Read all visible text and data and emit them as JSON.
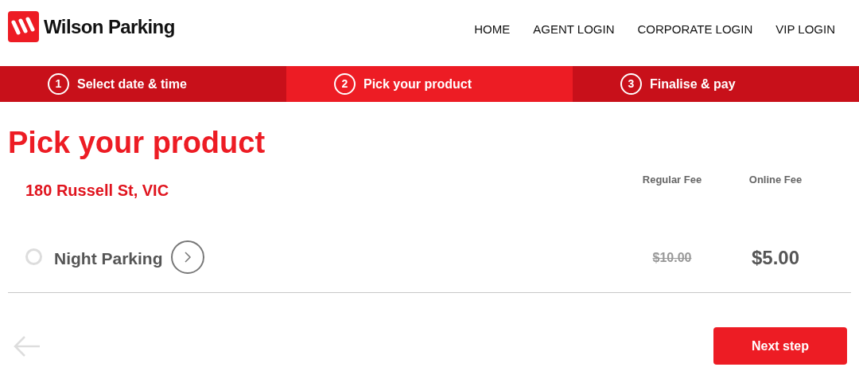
{
  "header": {
    "brand": "Wilson Parking",
    "nav": [
      "HOME",
      "AGENT LOGIN",
      "CORPORATE LOGIN",
      "VIP LOGIN"
    ]
  },
  "steps": [
    {
      "number": "1",
      "label": "Select date & time",
      "selected": false
    },
    {
      "number": "2",
      "label": "Pick your product",
      "selected": true
    },
    {
      "number": "3",
      "label": "Finalise & pay",
      "selected": false
    }
  ],
  "title": "Pick your product",
  "location": "180 Russell St, VIC",
  "columns": [
    "Regular Fee",
    "Online Fee"
  ],
  "products": [
    {
      "name": "Night Parking",
      "selected": false,
      "regular_fee": "$10.00",
      "online_fee": "$5.00"
    }
  ],
  "footer": {
    "next_button": "Next step"
  }
}
